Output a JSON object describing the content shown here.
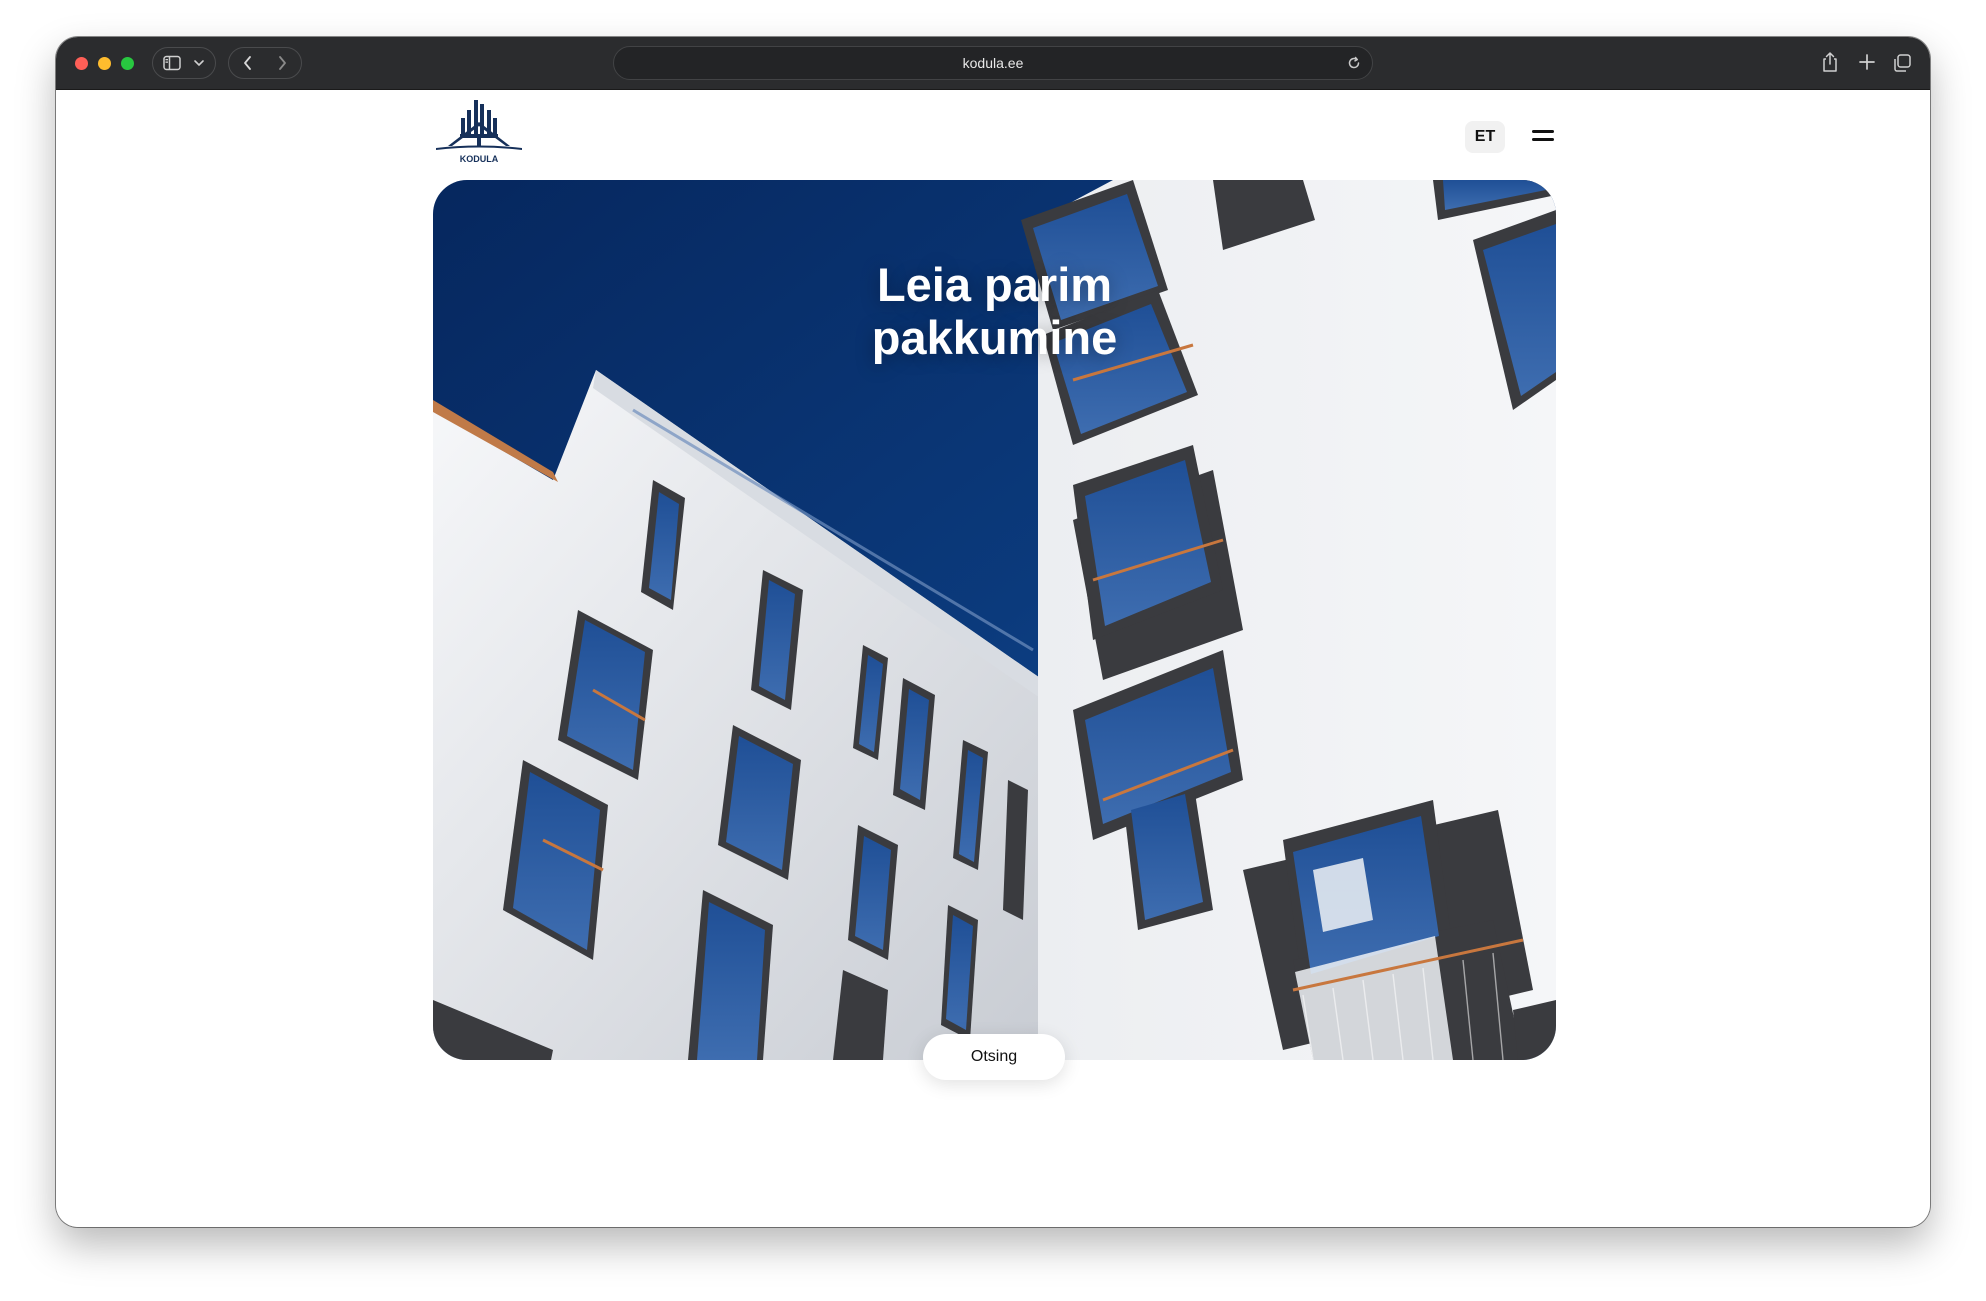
{
  "browser": {
    "url": "kodula.ee"
  },
  "site": {
    "logo_text": "KODULA",
    "brand_color": "#16305a",
    "language": "ET"
  },
  "hero": {
    "title_line1": "Leia parim",
    "title_line2": "pakkumine",
    "search_label": "Otsing"
  },
  "icons": [
    "sidebar-icon",
    "chevron-down-icon",
    "back-icon",
    "forward-icon",
    "reload-icon",
    "share-icon",
    "new-tab-icon",
    "tabs-overview-icon",
    "hamburger-menu-icon"
  ]
}
